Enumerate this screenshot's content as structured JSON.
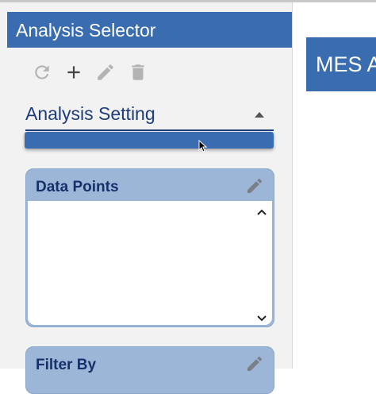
{
  "analysis_selector": {
    "title": "Analysis Selector",
    "toolbar": {
      "refresh_icon": "refresh-icon",
      "add_icon": "plus-icon",
      "edit_icon": "pencil-icon",
      "delete_icon": "trash-icon"
    },
    "dropdown": {
      "label": "Analysis Setting",
      "selected_value": ""
    },
    "data_points": {
      "title": "Data Points"
    },
    "filter_by": {
      "title": "Filter By"
    }
  },
  "main": {
    "title": "MES A"
  },
  "colors": {
    "header_blue": "#3a6db0",
    "label_navy": "#1f3d78",
    "card_blue": "#9cb6d8",
    "panel_bg": "#f2f2f2"
  }
}
